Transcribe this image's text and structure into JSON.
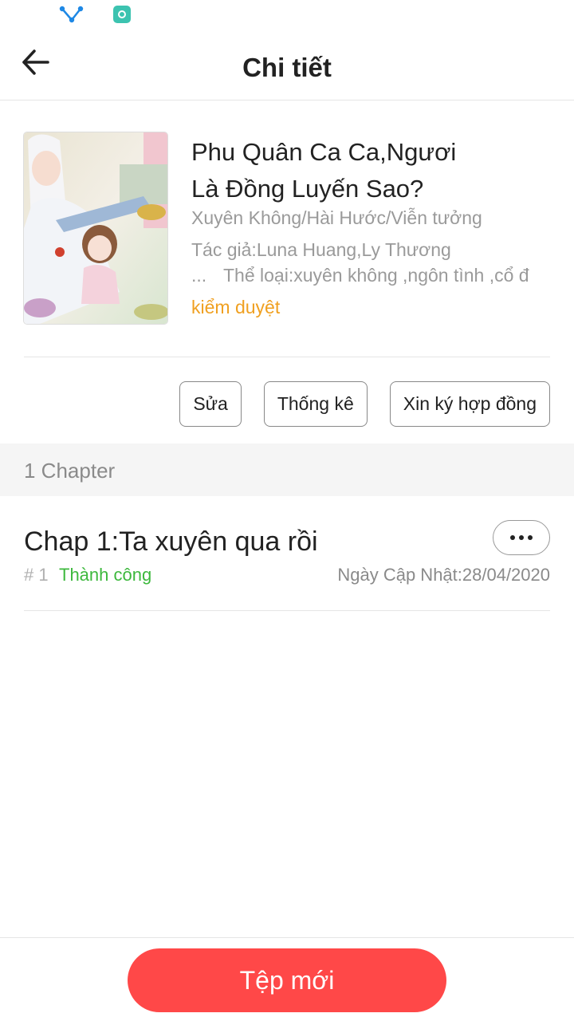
{
  "status_bar": {
    "icons": [
      "network-share-icon",
      "app-notification-icon"
    ]
  },
  "header": {
    "title": "Chi tiết",
    "back_icon": "arrow-left-icon"
  },
  "book": {
    "title": "Phu Quân Ca Ca,Ngươi Là Đồng Luyến Sao?",
    "genres": "Xuyên Không/Hài Hước/Viễn tưởng",
    "author": "Tác giả:Luna Huang,Ly Thương",
    "description_prefix": "...",
    "description": "Thể loại:xuyên không ,ngôn tình ,cổ đ",
    "status": "kiểm duyệt",
    "status_color": "#f0a020"
  },
  "actions": {
    "edit_label": "Sửa",
    "stats_label": "Thống kê",
    "contract_label": "Xin ký hợp đồng"
  },
  "chapters": {
    "count_label": "1 Chapter",
    "items": [
      {
        "title": "Chap 1:Ta xuyên qua rồi",
        "number": "# 1",
        "status": "Thành công",
        "status_color": "#3db83d",
        "updated": "Ngày Cập Nhật:28/04/2020",
        "more_icon": "ellipsis-icon"
      }
    ]
  },
  "footer": {
    "new_file_label": "Tệp mới",
    "accent_color": "#ff4848"
  }
}
